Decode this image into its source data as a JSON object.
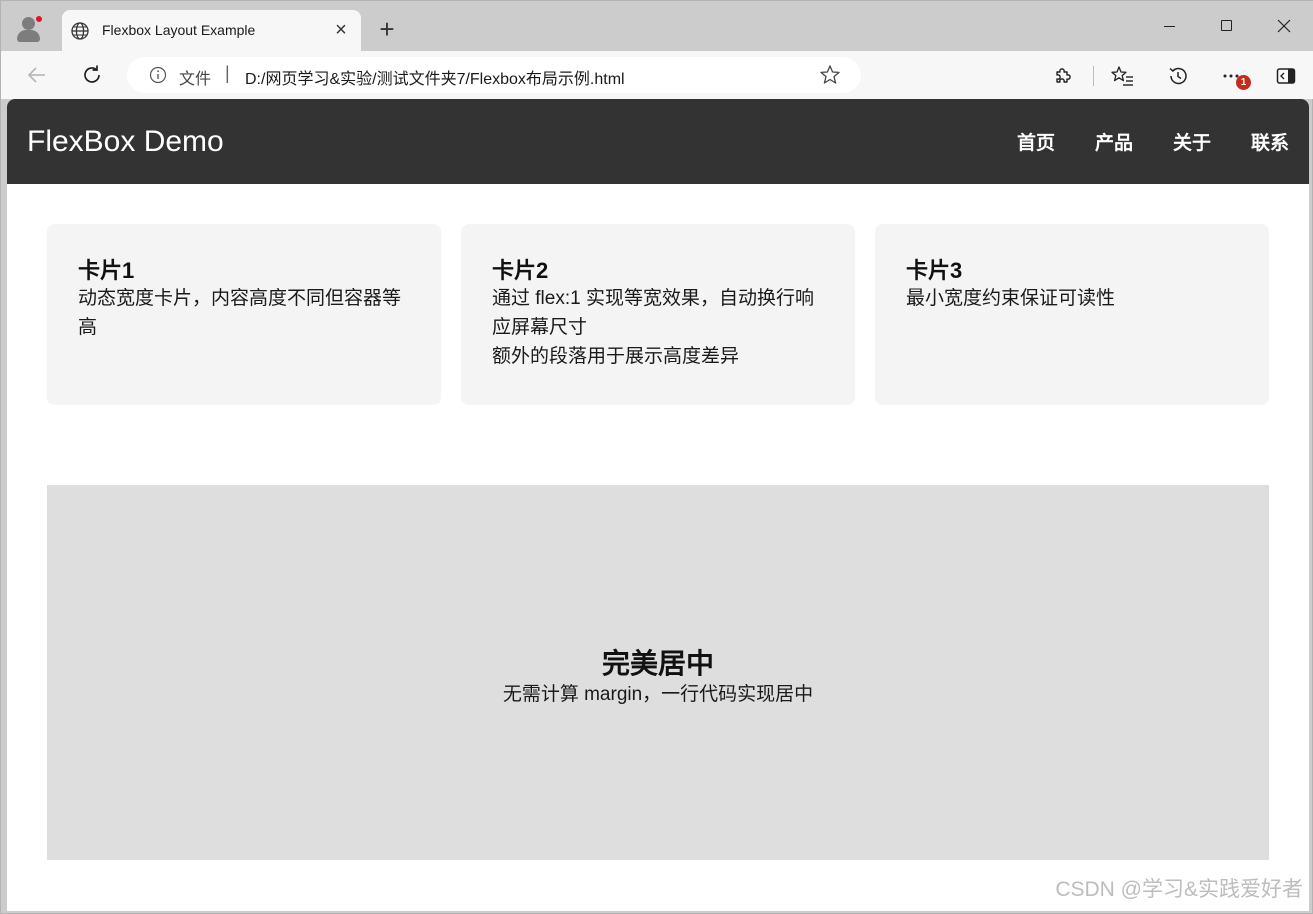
{
  "browser": {
    "tab_title": "Flexbox Layout Example",
    "tab_close": "×",
    "new_tab": "+",
    "address": {
      "scheme_label": "文件",
      "separator": "|",
      "url": "D:/网页学习&实验/测试文件夹7/Flexbox布局示例.html"
    },
    "menu_badge": "1"
  },
  "page": {
    "logo": "FlexBox Demo",
    "nav_links": [
      "首页",
      "产品",
      "关于",
      "联系"
    ],
    "cards": [
      {
        "title": "卡片1",
        "lines": [
          "动态宽度卡片，内容高度不同但容器等高"
        ]
      },
      {
        "title": "卡片2",
        "lines": [
          "通过 flex:1 实现等宽效果，自动换行响应屏幕尺寸",
          "额外的段落用于展示高度差异"
        ]
      },
      {
        "title": "卡片3",
        "lines": [
          "最小宽度约束保证可读性"
        ]
      }
    ],
    "center": {
      "title": "完美居中",
      "subtitle": "无需计算 margin，一行代码实现居中"
    }
  },
  "watermark": "CSDN @学习&实践爱好者",
  "colors": {
    "nav_bg": "#333333",
    "card_bg": "#f4f4f4",
    "center_bg": "#dedede",
    "browser_chrome": "#cccccc",
    "badge": "#c42b1c"
  }
}
